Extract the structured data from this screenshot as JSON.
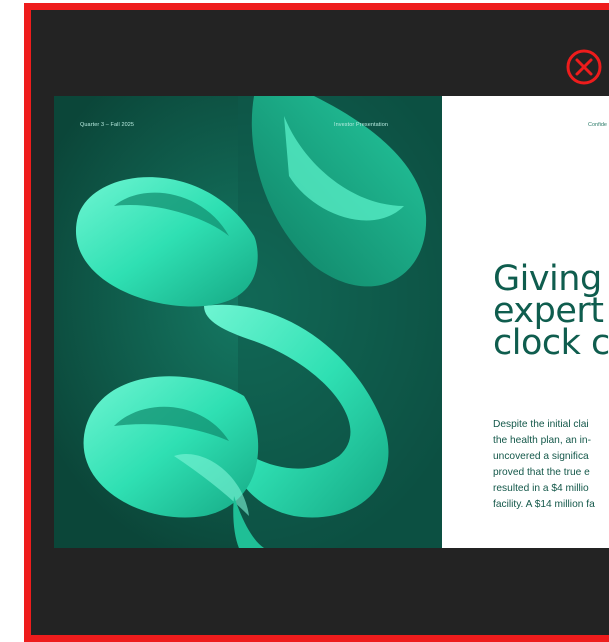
{
  "viewer": {
    "close_icon": "close-circle-x-icon",
    "accent_color": "#ee1c1c",
    "background_color": "#232323"
  },
  "slide": {
    "cover": {
      "left_meta": "Quarter 3 – Fall 2025",
      "right_meta": "Investor Presentation",
      "artwork": "mint-ribbon-s-artwork",
      "background_color": "#0e4f43",
      "ribbon_color": "#2ee6b8"
    },
    "content": {
      "corner_label": "Confide",
      "headline_lines": [
        "Giving",
        "expert",
        "clock c"
      ],
      "body_lines": [
        "Despite the initial clai",
        "the health plan, an in-",
        "uncovered a significa",
        "proved that the true e",
        "resulted in a $4 millio",
        "facility. A $14 million fa"
      ],
      "headline_color": "#0f5d4e"
    }
  }
}
